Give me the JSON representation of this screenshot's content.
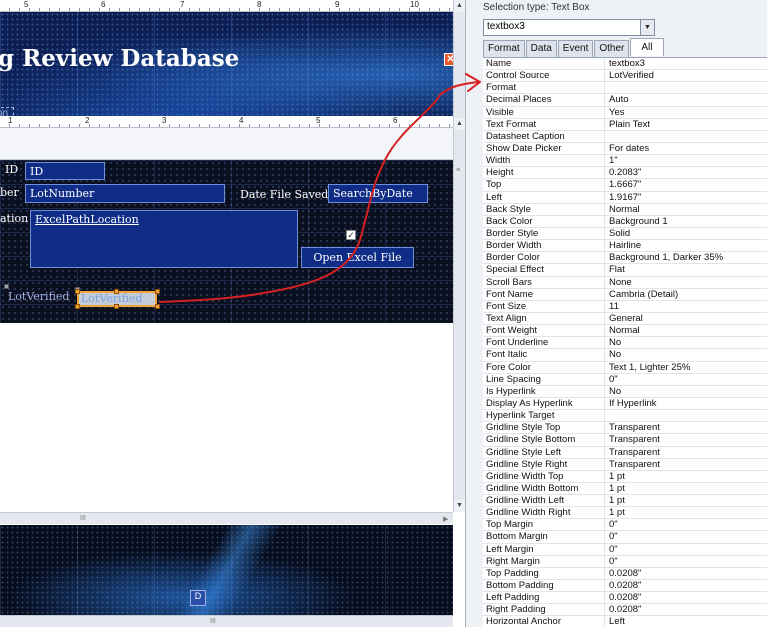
{
  "ruler_top": [
    "5",
    "6",
    "7",
    "8",
    "9",
    "10"
  ],
  "ruler_mid": [
    "1",
    "2",
    "3",
    "4",
    "5",
    "6"
  ],
  "header": {
    "title": "g Review Database",
    "close_icon": "close-icon",
    "chip_text": "on"
  },
  "detail": {
    "id_label": "ID",
    "id_box": "ID",
    "lotnumber_label": "ber",
    "lotnumber_box": "LotNumber",
    "datefile_label": "Date File Saved",
    "searchbydate_box": "SearchByDate",
    "excelpath_label": "ation",
    "excelpath_box": "ExcelPathLocation",
    "open_excel_button": "Open Excel File",
    "lotverified_label": "LotVerified",
    "lotverified_box": "LotVerified",
    "checkbox_mark": "✓"
  },
  "footer": {
    "chip_text": "D"
  },
  "scroll": {
    "grip": "III",
    "up": "▲",
    "down": "▼",
    "left": "◀",
    "right": "▶",
    "vgrip": "≡"
  },
  "property_sheet": {
    "selection_type": "Selection type:  Text Box",
    "selected_object": "textbox3",
    "combo_arrow": "▼",
    "tabs": [
      "Format",
      "Data",
      "Event",
      "Other",
      "All"
    ],
    "active_tab": "All",
    "properties": [
      {
        "name": "Name",
        "value": "textbox3"
      },
      {
        "name": "Control Source",
        "value": "LotVerified"
      },
      {
        "name": "Format",
        "value": ""
      },
      {
        "name": "Decimal Places",
        "value": "Auto"
      },
      {
        "name": "Visible",
        "value": "Yes"
      },
      {
        "name": "Text Format",
        "value": "Plain Text"
      },
      {
        "name": "Datasheet Caption",
        "value": ""
      },
      {
        "name": "Show Date Picker",
        "value": "For dates"
      },
      {
        "name": "Width",
        "value": "1\""
      },
      {
        "name": "Height",
        "value": "0.2083\""
      },
      {
        "name": "Top",
        "value": "1.6667\""
      },
      {
        "name": "Left",
        "value": "1.9167\""
      },
      {
        "name": "Back Style",
        "value": "Normal"
      },
      {
        "name": "Back Color",
        "value": "Background 1"
      },
      {
        "name": "Border Style",
        "value": "Solid"
      },
      {
        "name": "Border Width",
        "value": "Hairline"
      },
      {
        "name": "Border Color",
        "value": "Background 1, Darker 35%"
      },
      {
        "name": "Special Effect",
        "value": "Flat"
      },
      {
        "name": "Scroll Bars",
        "value": "None"
      },
      {
        "name": "Font Name",
        "value": "Cambria (Detail)"
      },
      {
        "name": "Font Size",
        "value": "11"
      },
      {
        "name": "Text Align",
        "value": "General"
      },
      {
        "name": "Font Weight",
        "value": "Normal"
      },
      {
        "name": "Font Underline",
        "value": "No"
      },
      {
        "name": "Font Italic",
        "value": "No"
      },
      {
        "name": "Fore Color",
        "value": "Text 1, Lighter 25%"
      },
      {
        "name": "Line Spacing",
        "value": "0\""
      },
      {
        "name": "Is Hyperlink",
        "value": "No"
      },
      {
        "name": "Display As Hyperlink",
        "value": "If Hyperlink"
      },
      {
        "name": "Hyperlink Target",
        "value": ""
      },
      {
        "name": "Gridline Style Top",
        "value": "Transparent"
      },
      {
        "name": "Gridline Style Bottom",
        "value": "Transparent"
      },
      {
        "name": "Gridline Style Left",
        "value": "Transparent"
      },
      {
        "name": "Gridline Style Right",
        "value": "Transparent"
      },
      {
        "name": "Gridline Width Top",
        "value": "1 pt"
      },
      {
        "name": "Gridline Width Bottom",
        "value": "1 pt"
      },
      {
        "name": "Gridline Width Left",
        "value": "1 pt"
      },
      {
        "name": "Gridline Width Right",
        "value": "1 pt"
      },
      {
        "name": "Top Margin",
        "value": "0\""
      },
      {
        "name": "Bottom Margin",
        "value": "0\""
      },
      {
        "name": "Left Margin",
        "value": "0\""
      },
      {
        "name": "Right Margin",
        "value": "0\""
      },
      {
        "name": "Top Padding",
        "value": "0.0208\""
      },
      {
        "name": "Bottom Padding",
        "value": "0.0208\""
      },
      {
        "name": "Left Padding",
        "value": "0.0208\""
      },
      {
        "name": "Right Padding",
        "value": "0.0208\""
      },
      {
        "name": "Horizontal Anchor",
        "value": "Left"
      }
    ]
  },
  "colors": {
    "annotation": "#d42020",
    "control_fill": "#0f2c86",
    "selected_control_fill": "#c4ccd8",
    "selected_control_text": "#7aa3e0",
    "handle": "#f2a33a"
  }
}
